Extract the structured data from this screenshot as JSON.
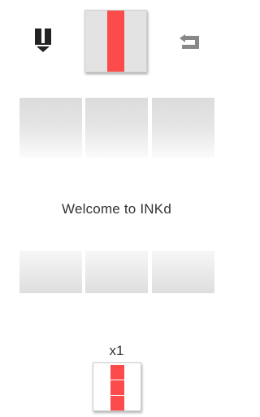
{
  "game": {
    "welcome_text": "Welcome to INKd",
    "next_count": "x1"
  },
  "icons": {
    "pause": "pause-icon",
    "undo": "undo-icon"
  },
  "colors": {
    "piece_red": "#fb4b4b",
    "piece_bg": "#e3e3e3",
    "tile_gray": "#dcdcdc",
    "icon_dark": "#222222",
    "icon_gray": "#888888"
  }
}
